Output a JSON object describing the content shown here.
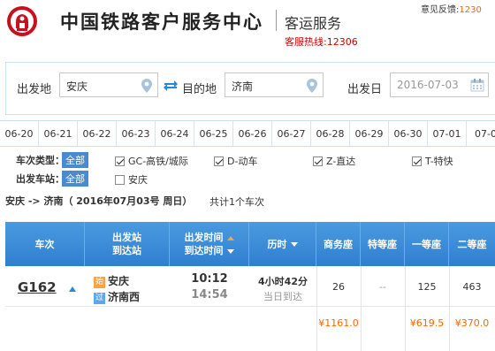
{
  "header": {
    "site_title": "中国铁路客户服务中心",
    "subtitle": "客运服务",
    "hotline": "客服热线:12306",
    "feedback": "意见反馈:",
    "feedback_link": "1230"
  },
  "search": {
    "from_label": "出发地",
    "from_value": "安庆",
    "to_label": "目的地",
    "to_value": "济南",
    "date_label": "出发日",
    "date_placeholder": "2016-07-03"
  },
  "date_tabs": [
    "06-20",
    "06-21",
    "06-22",
    "06-23",
    "06-24",
    "06-25",
    "06-26",
    "06-27",
    "06-28",
    "06-29",
    "06-30",
    "07-01",
    "07-0"
  ],
  "filters": {
    "type_label": "车次类型：",
    "all_label": "全部",
    "types": [
      {
        "label": "GC-高铁/城际",
        "checked": true
      },
      {
        "label": "D-动车",
        "checked": true
      },
      {
        "label": "Z-直达",
        "checked": true
      },
      {
        "label": "T-特快",
        "checked": true
      }
    ],
    "station_label": "出发车站：",
    "station_all_label": "全部",
    "stations": [
      {
        "label": "安庆",
        "checked": false
      }
    ]
  },
  "route": {
    "text": "安庆 -> 济南（ 2016年07月03号  周日）",
    "count": "共计1个车次"
  },
  "table": {
    "headers": {
      "train": "车次",
      "station_1": "出发站",
      "station_2": "到达站",
      "time_1": "出发时间",
      "time_2": "到达时间",
      "duration": "历时",
      "business": "商务座",
      "special": "特等座",
      "first": "一等座",
      "second": "二等座"
    },
    "row": {
      "train_no": "G162",
      "from_badge": "始",
      "from_station": "安庆",
      "to_badge": "过",
      "to_station": "济南西",
      "depart_time": "10:12",
      "arrive_time": "14:54",
      "duration": "4小时42分",
      "arrival_day": "当日到达",
      "business": "26",
      "special": "--",
      "first": "125",
      "second": "463"
    },
    "prices": {
      "business": "¥1161.0",
      "first": "¥619.5",
      "second": "¥370.0"
    }
  },
  "colors": {
    "brand_red": "#c00",
    "accent_blue": "#3b88d6",
    "price_orange": "#f60"
  }
}
